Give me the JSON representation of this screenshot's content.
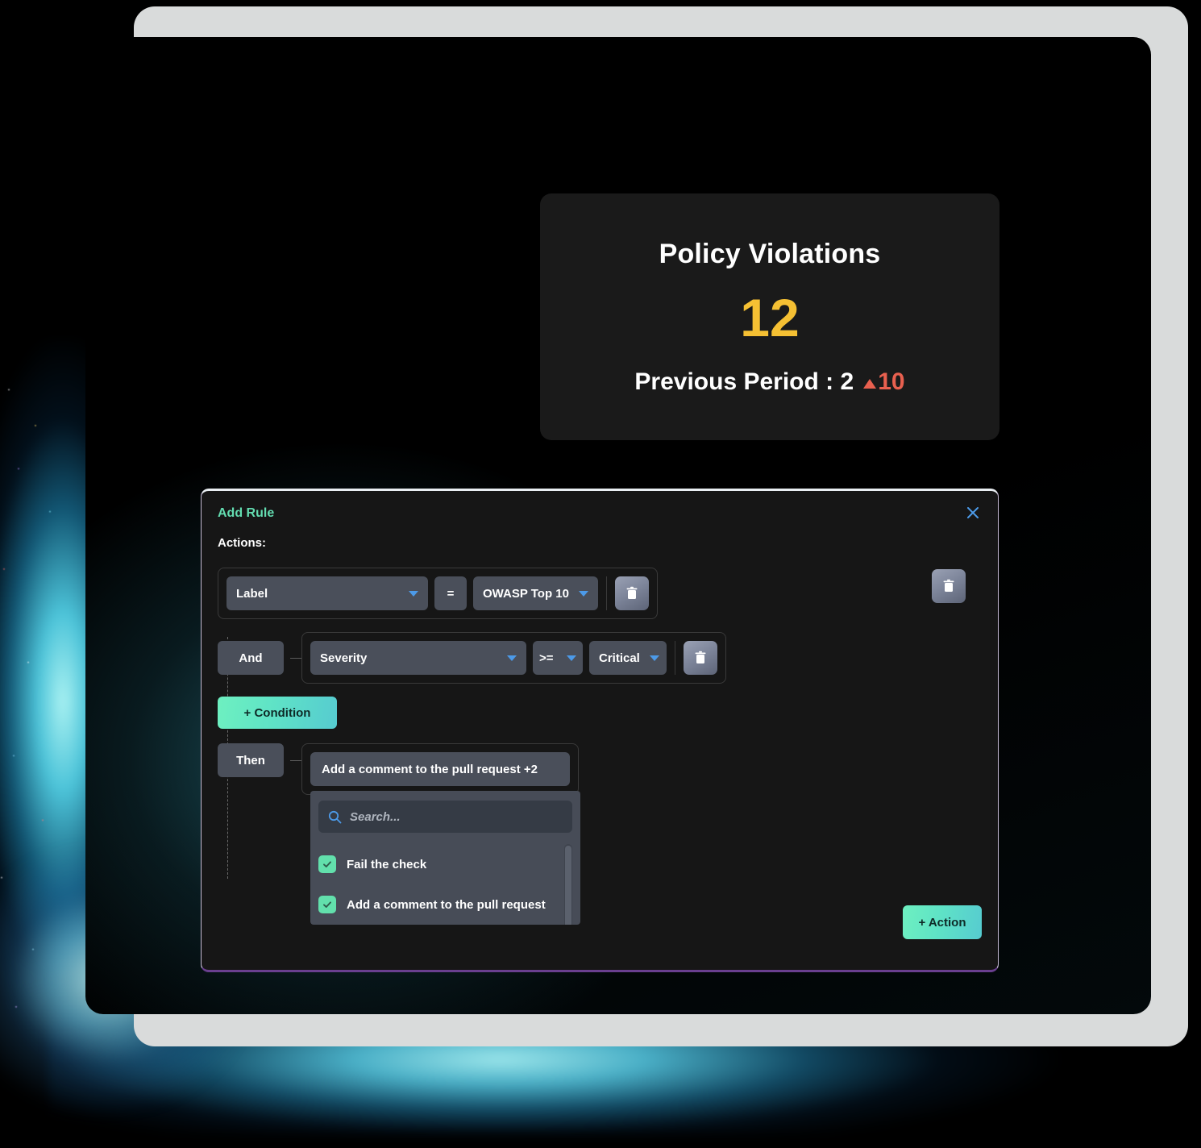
{
  "kpi": {
    "title": "Policy Violations",
    "value": "12",
    "previous_label": "Previous Period : 2",
    "delta": "10",
    "delta_direction": "up",
    "value_color": "#f5c033",
    "delta_color": "#e8604f"
  },
  "dialog": {
    "title": "Add Rule",
    "close_icon": "close-icon",
    "accent_color": "#63dcb0",
    "section_label": "Actions:",
    "conditions": [
      {
        "joiner": "",
        "field": "Label",
        "operator": "=",
        "value": "OWASP Top 10",
        "delete_icon": "trash-icon"
      },
      {
        "joiner": "And",
        "field": "Severity",
        "operator": ">=",
        "value": "Critical",
        "delete_icon": "trash-icon"
      }
    ],
    "add_condition_label": "+ Condition",
    "then": {
      "joiner": "Then",
      "selected_summary": "Add a comment to the pull request +2",
      "dropdown": {
        "search_placeholder": "Search...",
        "search_value": "",
        "search_icon": "search-icon",
        "options": [
          {
            "label": "Fail the check",
            "checked": true
          },
          {
            "label": "Add a comment to the pull request",
            "checked": true
          }
        ]
      }
    },
    "add_action_label": "+ Action",
    "group_delete_icon": "trash-icon"
  }
}
